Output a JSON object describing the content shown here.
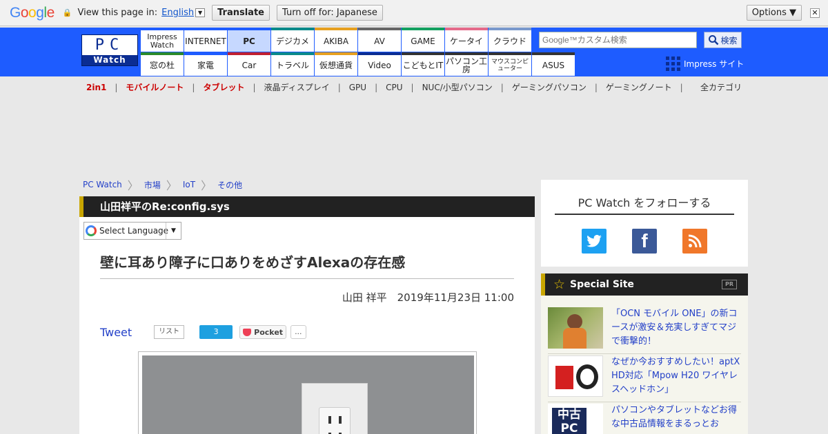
{
  "translate_bar": {
    "logo": "Google",
    "view_text": "View this page in:",
    "language": "English",
    "translate_btn": "Translate",
    "turnoff_btn": "Turn off for: Japanese",
    "options_btn": "Options ▼",
    "close": "✕"
  },
  "site": {
    "logo_top": "PC",
    "logo_bottom": "Watch",
    "search_placeholder": "Google™カスタム検索",
    "search_btn": "検索",
    "impress_link": "Impress サイト"
  },
  "nav_top": [
    {
      "label": "Impress Watch",
      "color": "#1e5cff"
    },
    {
      "label": "INTERNET",
      "color": "#1e5cff"
    },
    {
      "label": "PC",
      "color": "#1e5cff"
    },
    {
      "label": "デジカメ",
      "color": "#0b8a8a"
    },
    {
      "label": "AKIBA",
      "color": "#e6a020"
    },
    {
      "label": "AV",
      "color": "#666666"
    },
    {
      "label": "GAME",
      "color": "#13a060"
    },
    {
      "label": "ケータイ",
      "color": "#e46a8a"
    },
    {
      "label": "クラウド",
      "color": "#7a99cc"
    }
  ],
  "nav_bottom": [
    {
      "label": "窓の杜",
      "color": "#2b8a2b"
    },
    {
      "label": "家電",
      "color": "#1e5cff"
    },
    {
      "label": "Car",
      "color": "#c02030"
    },
    {
      "label": "トラベル",
      "color": "#0b8a8a"
    },
    {
      "label": "仮想通貨",
      "color": "#e6a020"
    },
    {
      "label": "Video",
      "color": "#0b2d92"
    },
    {
      "label": "こどもとIT",
      "color": "#333333"
    },
    {
      "label": "パソコン工房",
      "color": "#333333"
    },
    {
      "label": "マウスコンピューター",
      "color": "#333333"
    },
    {
      "label": "ASUS",
      "color": "#333333"
    }
  ],
  "subnav": [
    {
      "label": "2in1",
      "red": true
    },
    {
      "label": "モバイルノート",
      "red": true
    },
    {
      "label": "タブレット",
      "red": true
    },
    {
      "label": "液晶ディスプレイ",
      "red": false
    },
    {
      "label": "GPU",
      "red": false
    },
    {
      "label": "CPU",
      "red": false
    },
    {
      "label": "NUC/小型パソコン",
      "red": false
    },
    {
      "label": "ゲーミングパソコン",
      "red": false
    },
    {
      "label": "ゲーミングノート",
      "red": false
    }
  ],
  "all_categories": "全カテゴリ",
  "breadcrumb": [
    "PC Watch",
    "市場",
    "IoT",
    "その他"
  ],
  "article": {
    "category": "山田祥平のRe:config.sys",
    "lang_select": "Select Language",
    "title": "壁に耳あり障子に口ありをめざすAlexaの存在感",
    "byline": "山田 祥平　2019年11月23日 11:00",
    "tweet": "Tweet",
    "list_btn": "リスト",
    "hatena_count": "3",
    "pocket": "Pocket",
    "pocket_count": "..."
  },
  "sidebar": {
    "follow_title": "PC Watch をフォローする",
    "special_title": "Special Site",
    "pr": "PR",
    "items": [
      {
        "text": "「OCN モバイル ONE」の新コースが激安＆充実しすぎてマジで衝撃的！"
      },
      {
        "text": "なぜか今おすすめしたい！aptX HD対応「Mpow H20 ワイヤレスヘッドホン」"
      },
      {
        "text": "パソコンやタブレットなどお得な中古品情報をまるっとお"
      }
    ]
  }
}
